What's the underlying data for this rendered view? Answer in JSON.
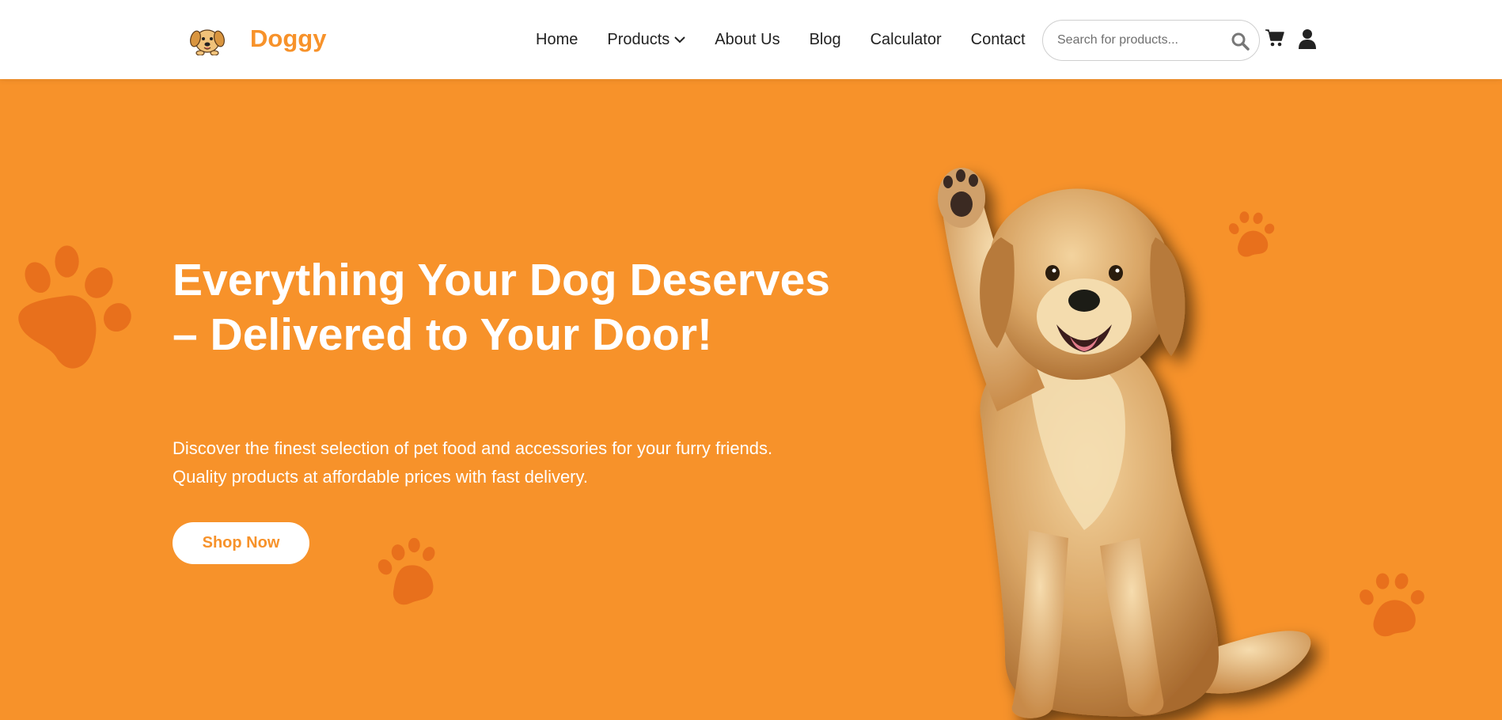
{
  "header": {
    "logo_text": "Doggy",
    "nav": [
      {
        "label": "Home"
      },
      {
        "label": "Products",
        "has_dropdown": true
      },
      {
        "label": "About Us"
      },
      {
        "label": "Blog"
      },
      {
        "label": "Calculator"
      },
      {
        "label": "Contact"
      }
    ],
    "search": {
      "placeholder": "Search for products...",
      "value": ""
    },
    "icons": [
      "search-icon",
      "cart-icon",
      "user-icon"
    ]
  },
  "hero": {
    "title": "Everything Your Dog Deserves – Delivered to Your Door!",
    "subtitle": "Discover the finest selection of pet food and accessories for your furry friends. Quality products at affordable prices with fast delivery.",
    "cta_label": "Shop Now"
  },
  "colors": {
    "brand_orange": "#f7922a",
    "paw_orange": "#e8701c",
    "header_bg": "#ffffff",
    "text_dark": "#222222",
    "text_light": "#ffffff"
  }
}
